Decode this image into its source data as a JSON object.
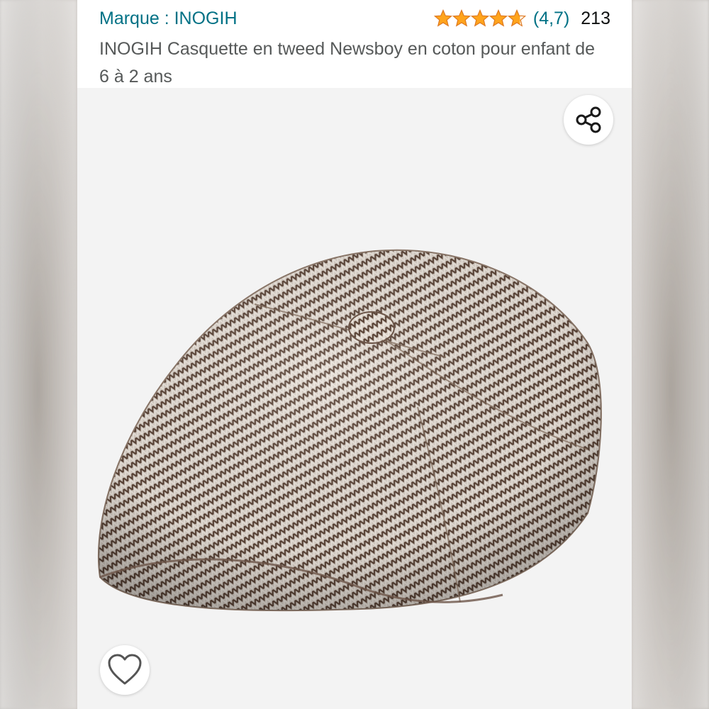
{
  "listing": {
    "brand_label": "Marque : INOGIH",
    "rating": {
      "stars": 4.7,
      "value_label": "(4,7)",
      "count": "213"
    },
    "title": "INOGIH Casquette en tweed Newsboy en coton pour enfant de 6 à 2 ans"
  },
  "gallery": {
    "share_icon": "share-icon",
    "wishlist_icon": "heart-icon",
    "product_image": "herringbone tweed newsboy cap"
  },
  "colors": {
    "link": "#007185",
    "star": "#ffa41c",
    "title_text": "#565959",
    "image_bg": "#f3f3f3"
  }
}
